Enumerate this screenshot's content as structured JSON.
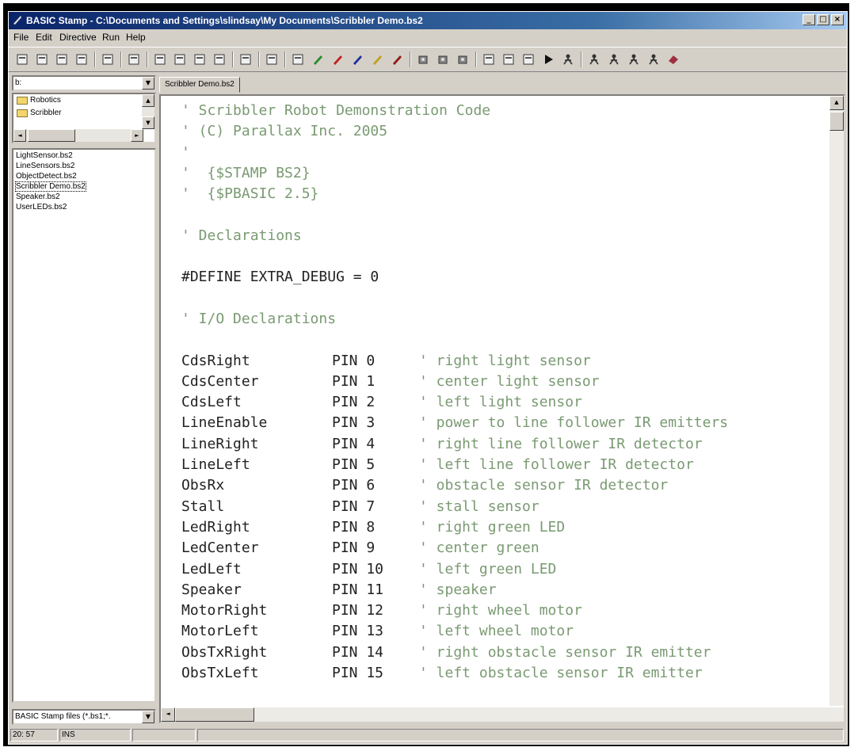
{
  "window": {
    "title": "BASIC Stamp - C:\\Documents and Settings\\slindsay\\My Documents\\Scribbler Demo.bs2",
    "buttons": [
      "_",
      "□",
      "×"
    ]
  },
  "menu": [
    "File",
    "Edit",
    "Directive",
    "Run",
    "Help"
  ],
  "toolbar_icons": [
    "new-icon",
    "open-icon",
    "open-from-icon",
    "save-icon",
    "find-icon",
    "print-icon",
    "cut-icon",
    "copy-icon",
    "paste-icon",
    "binoculars-icon",
    "split-icon",
    "properties-icon",
    "debug-icon",
    "pen-green-icon",
    "pen-red-icon",
    "pen-blue-icon",
    "pen-yellow-icon",
    "pen-darkred-icon",
    "chip1-icon",
    "chip2-icon",
    "chip3-icon",
    "memory-map-icon",
    "identify-icon",
    "terminal-icon",
    "run-icon",
    "figure-icon",
    "figure2-icon",
    "figure3-icon",
    "figure4-icon",
    "figure5-icon",
    "help-icon"
  ],
  "left": {
    "drive": "b:",
    "folders": [
      "Robotics",
      "Scribbler"
    ],
    "files": [
      "LightSensor.bs2",
      "LineSensors.bs2",
      "ObjectDetect.bs2",
      "Scribbler Demo.bs2",
      "Speaker.bs2",
      "UserLEDs.bs2"
    ],
    "selected_file": "Scribbler Demo.bs2",
    "filter": "BASIC Stamp files (*.bs1;*."
  },
  "editor": {
    "tab": "Scribbler Demo.bs2",
    "header_lines": [
      "' Scribbler Robot Demonstration Code",
      "' (C) Parallax Inc. 2005",
      "'",
      "'  {$STAMP BS2}",
      "'  {$PBASIC 2.5}"
    ],
    "declarations_comment": "' Declarations",
    "define_line": "#DEFINE EXTRA_DEBUG = 0",
    "io_comment": "' I/O Declarations",
    "pins": [
      {
        "name": "CdsRight",
        "pin": "PIN 0",
        "comment": "' right light sensor"
      },
      {
        "name": "CdsCenter",
        "pin": "PIN 1",
        "comment": "' center light sensor"
      },
      {
        "name": "CdsLeft",
        "pin": "PIN 2",
        "comment": "' left light sensor"
      },
      {
        "name": "LineEnable",
        "pin": "PIN 3",
        "comment": "' power to line follower IR emitters"
      },
      {
        "name": "LineRight",
        "pin": "PIN 4",
        "comment": "' right line follower IR detector"
      },
      {
        "name": "LineLeft",
        "pin": "PIN 5",
        "comment": "' left line follower IR detector"
      },
      {
        "name": "ObsRx",
        "pin": "PIN 6",
        "comment": "' obstacle sensor IR detector"
      },
      {
        "name": "Stall",
        "pin": "PIN 7",
        "comment": "' stall sensor"
      },
      {
        "name": "LedRight",
        "pin": "PIN 8",
        "comment": "' right green LED"
      },
      {
        "name": "LedCenter",
        "pin": "PIN 9",
        "comment": "' center green"
      },
      {
        "name": "LedLeft",
        "pin": "PIN 10",
        "comment": "' left green LED"
      },
      {
        "name": "Speaker",
        "pin": "PIN 11",
        "comment": "' speaker"
      },
      {
        "name": "MotorRight",
        "pin": "PIN 12",
        "comment": "' right wheel motor"
      },
      {
        "name": "MotorLeft",
        "pin": "PIN 13",
        "comment": "' left wheel motor"
      },
      {
        "name": "ObsTxRight",
        "pin": "PIN 14",
        "comment": "' right obstacle sensor IR emitter"
      },
      {
        "name": "ObsTxLeft",
        "pin": "PIN 15",
        "comment": "' left obstacle sensor IR emitter"
      }
    ]
  },
  "status": {
    "position": "20: 57",
    "mode": "INS"
  }
}
